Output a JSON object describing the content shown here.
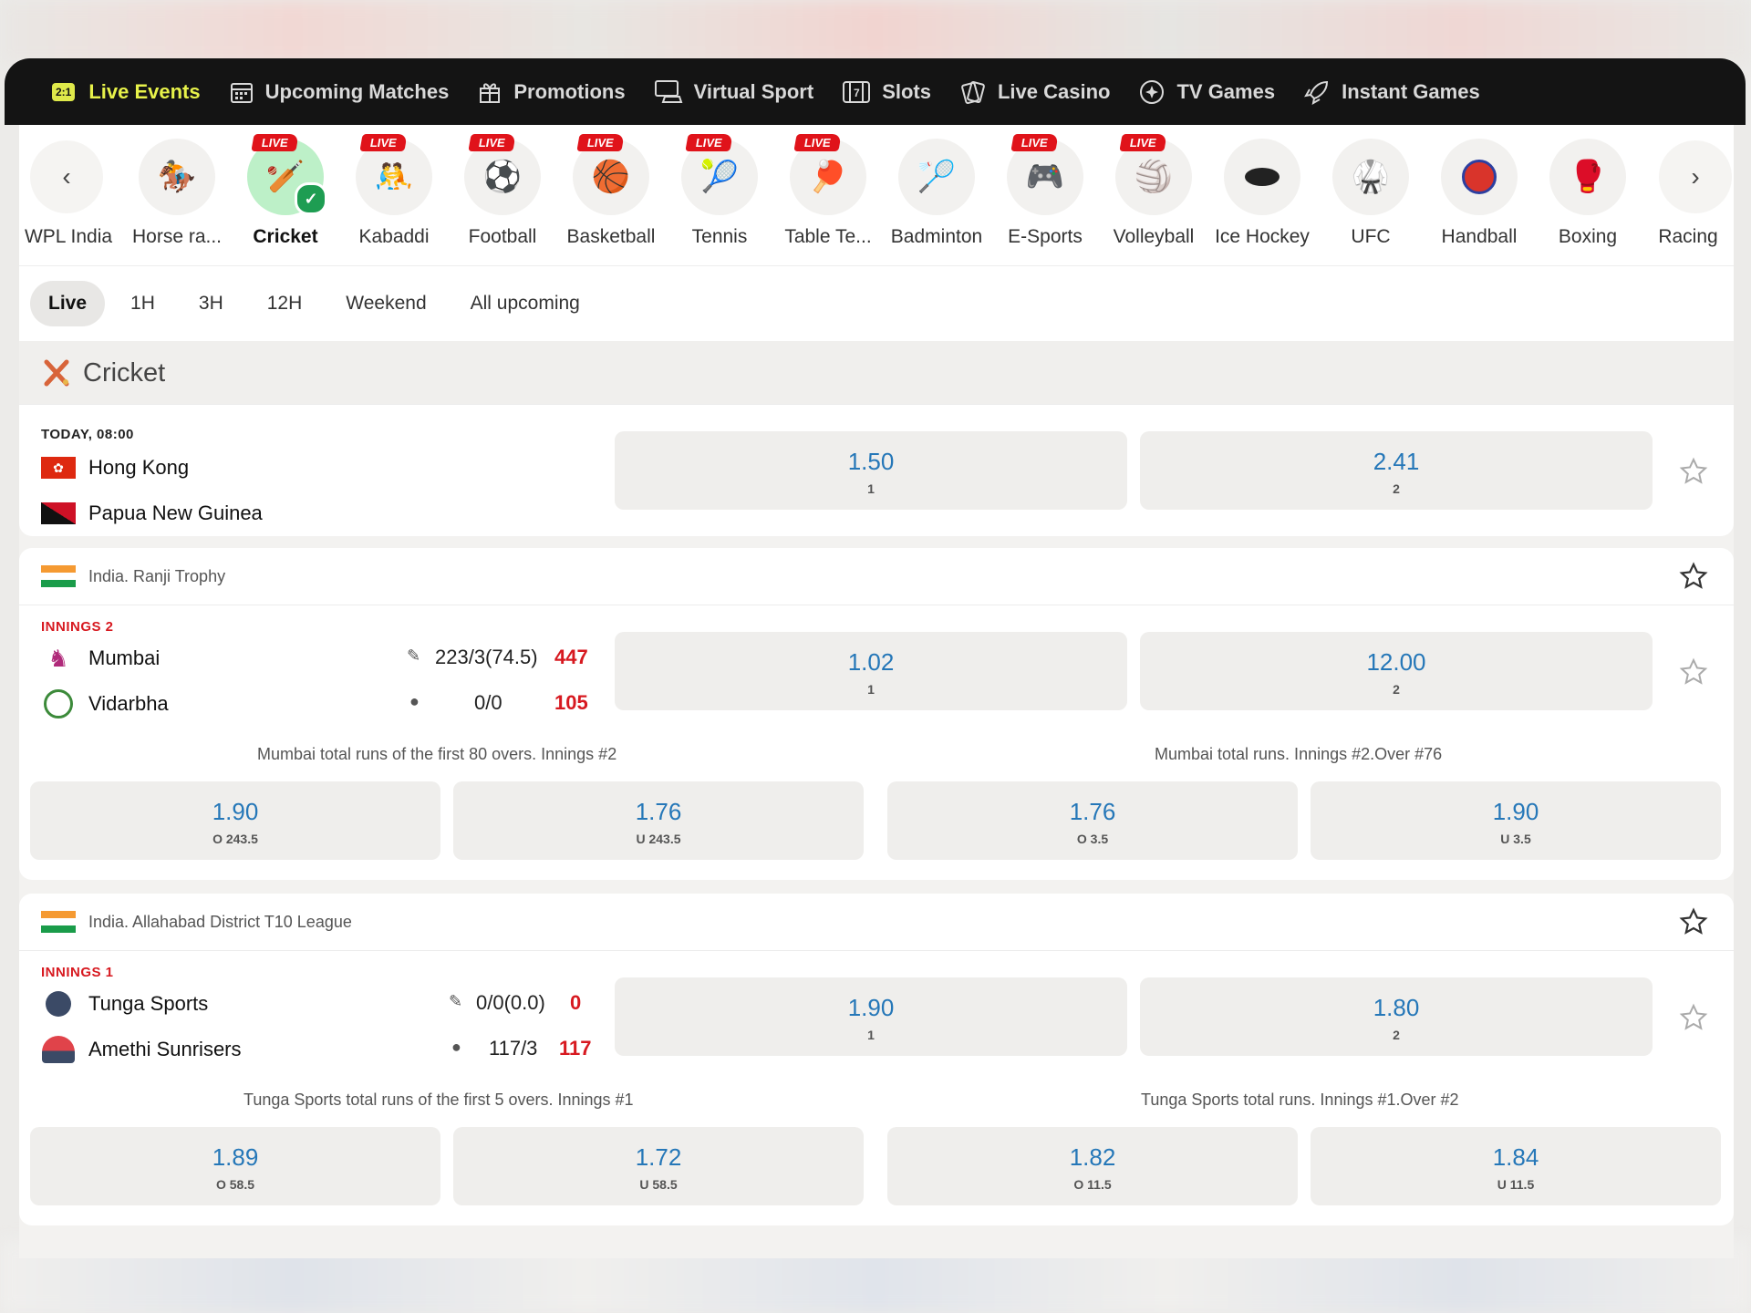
{
  "nav": {
    "items": [
      {
        "label": "Live Events",
        "icon": "score-21-icon",
        "active": true
      },
      {
        "label": "Upcoming Matches",
        "icon": "calendar-icon"
      },
      {
        "label": "Promotions",
        "icon": "gift-icon"
      },
      {
        "label": "Virtual Sport",
        "icon": "virtual-sport-icon"
      },
      {
        "label": "Slots",
        "icon": "slots-icon"
      },
      {
        "label": "Live Casino",
        "icon": "live-casino-icon"
      },
      {
        "label": "TV Games",
        "icon": "tv-games-icon"
      },
      {
        "label": "Instant Games",
        "icon": "rocket-icon"
      }
    ],
    "badge": "2:1"
  },
  "sports": [
    {
      "label": "WPL India",
      "live": false
    },
    {
      "label": "Horse ra...",
      "live": false
    },
    {
      "label": "Cricket",
      "live": true,
      "selected": true
    },
    {
      "label": "Kabaddi",
      "live": true
    },
    {
      "label": "Football",
      "live": true
    },
    {
      "label": "Basketball",
      "live": true
    },
    {
      "label": "Tennis",
      "live": true
    },
    {
      "label": "Table Te...",
      "live": true
    },
    {
      "label": "Badminton",
      "live": false
    },
    {
      "label": "E-Sports",
      "live": true
    },
    {
      "label": "Volleyball",
      "live": true
    },
    {
      "label": "Ice Hockey",
      "live": false
    },
    {
      "label": "UFC",
      "live": false
    },
    {
      "label": "Handball",
      "live": false
    },
    {
      "label": "Boxing",
      "live": false
    },
    {
      "label": "Racing",
      "live": false
    }
  ],
  "live_badge": "LIVE",
  "filters": [
    "Live",
    "1H",
    "3H",
    "12H",
    "Weekend",
    "All upcoming"
  ],
  "section_title": "Cricket",
  "match1": {
    "time": "TODAY, 08:00",
    "team1": "Hong Kong",
    "team2": "Papua New Guinea",
    "odds": [
      {
        "v": "1.50",
        "s": "1"
      },
      {
        "v": "2.41",
        "s": "2"
      }
    ]
  },
  "match2": {
    "league": "India. Ranji Trophy",
    "innings": "INNINGS 2",
    "team1": "Mumbai",
    "team1_score": "223/3(74.5)",
    "team1_total": "447",
    "team2": "Vidarbha",
    "team2_score": "0/0",
    "team2_total": "105",
    "odds": [
      {
        "v": "1.02",
        "s": "1"
      },
      {
        "v": "12.00",
        "s": "2"
      }
    ],
    "market1": "Mumbai total runs of the first 80 overs. Innings #2",
    "market2": "Mumbai total runs. Innings #2.Over #76",
    "sub_odds": [
      {
        "v": "1.90",
        "s": "O 243.5"
      },
      {
        "v": "1.76",
        "s": "U 243.5"
      },
      {
        "v": "1.76",
        "s": "O 3.5"
      },
      {
        "v": "1.90",
        "s": "U 3.5"
      }
    ]
  },
  "match3": {
    "league": "India. Allahabad District T10 League",
    "innings": "INNINGS 1",
    "team1": "Tunga Sports",
    "team1_score": "0/0(0.0)",
    "team1_total": "0",
    "team2": "Amethi Sunrisers",
    "team2_score": "117/3",
    "team2_total": "117",
    "odds": [
      {
        "v": "1.90",
        "s": "1"
      },
      {
        "v": "1.80",
        "s": "2"
      }
    ],
    "market1": "Tunga Sports total runs of the first 5 overs. Innings #1",
    "market2": "Tunga Sports total runs. Innings #1.Over #2",
    "sub_odds": [
      {
        "v": "1.89",
        "s": "O 58.5"
      },
      {
        "v": "1.72",
        "s": "U 58.5"
      },
      {
        "v": "1.82",
        "s": "O 11.5"
      },
      {
        "v": "1.84",
        "s": "U 11.5"
      }
    ]
  },
  "colors": {
    "accent": "#e7f24a",
    "odds": "#2577b8",
    "live": "#e0131a",
    "innings": "#d71920",
    "nav_bg": "#141414"
  }
}
